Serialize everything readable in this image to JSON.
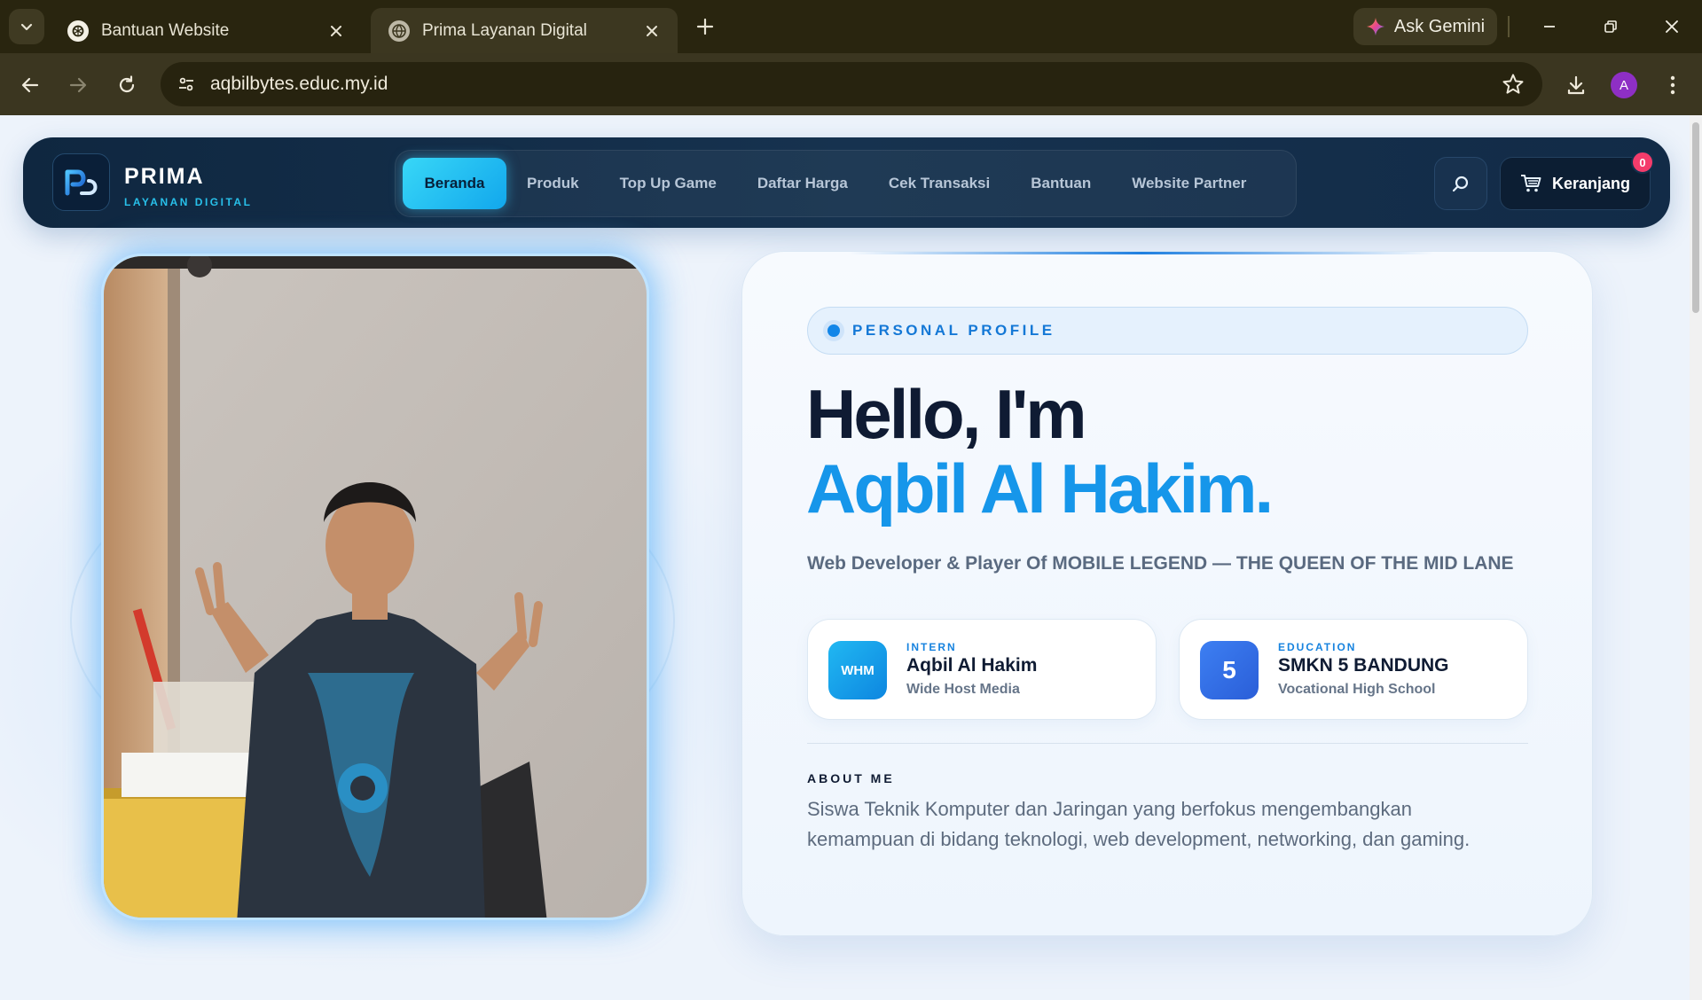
{
  "browser": {
    "tabs": [
      {
        "title": "Bantuan Website",
        "icon": "chatgpt-icon"
      },
      {
        "title": "Prima Layanan Digital",
        "icon": "globe-icon"
      }
    ],
    "gemini_label": "Ask Gemini",
    "url": "aqbilbytes.educ.my.id",
    "profile_initial": "A"
  },
  "site": {
    "brand": "PRIMA",
    "brand_sub": "LAYANAN DIGITAL",
    "menu": [
      {
        "label": "Beranda",
        "active": true
      },
      {
        "label": "Produk"
      },
      {
        "label": "Top Up Game"
      },
      {
        "label": "Daftar Harga"
      },
      {
        "label": "Cek Transaksi"
      },
      {
        "label": "Bantuan"
      },
      {
        "label": "Website Partner"
      }
    ],
    "cart_label": "Keranjang",
    "cart_count": "0"
  },
  "profile": {
    "badge": "PERSONAL PROFILE",
    "hello": "Hello, I'm",
    "name": "Aqbil Al Hakim.",
    "role": "Web Developer & Player Of MOBILE LEGEND — THE QUEEN OF THE MID LANE",
    "cards": [
      {
        "icon_text": "WHM",
        "kicker": "INTERN",
        "title": "Aqbil Al Hakim",
        "subtitle": "Wide Host Media"
      },
      {
        "icon_text": "5",
        "kicker": "EDUCATION",
        "title": "SMKN 5 BANDUNG",
        "subtitle": "Vocational High School"
      }
    ],
    "about_label": "ABOUT ME",
    "about_text": "Siswa Teknik Komputer dan Jaringan yang berfokus mengembangkan kemampuan di bidang teknologi, web development, networking, dan gaming."
  },
  "colors": {
    "accent": "#1696ea",
    "nav_bg": "#16324f",
    "active_tab": "#38d7f7",
    "badge": "#f43c6b"
  }
}
